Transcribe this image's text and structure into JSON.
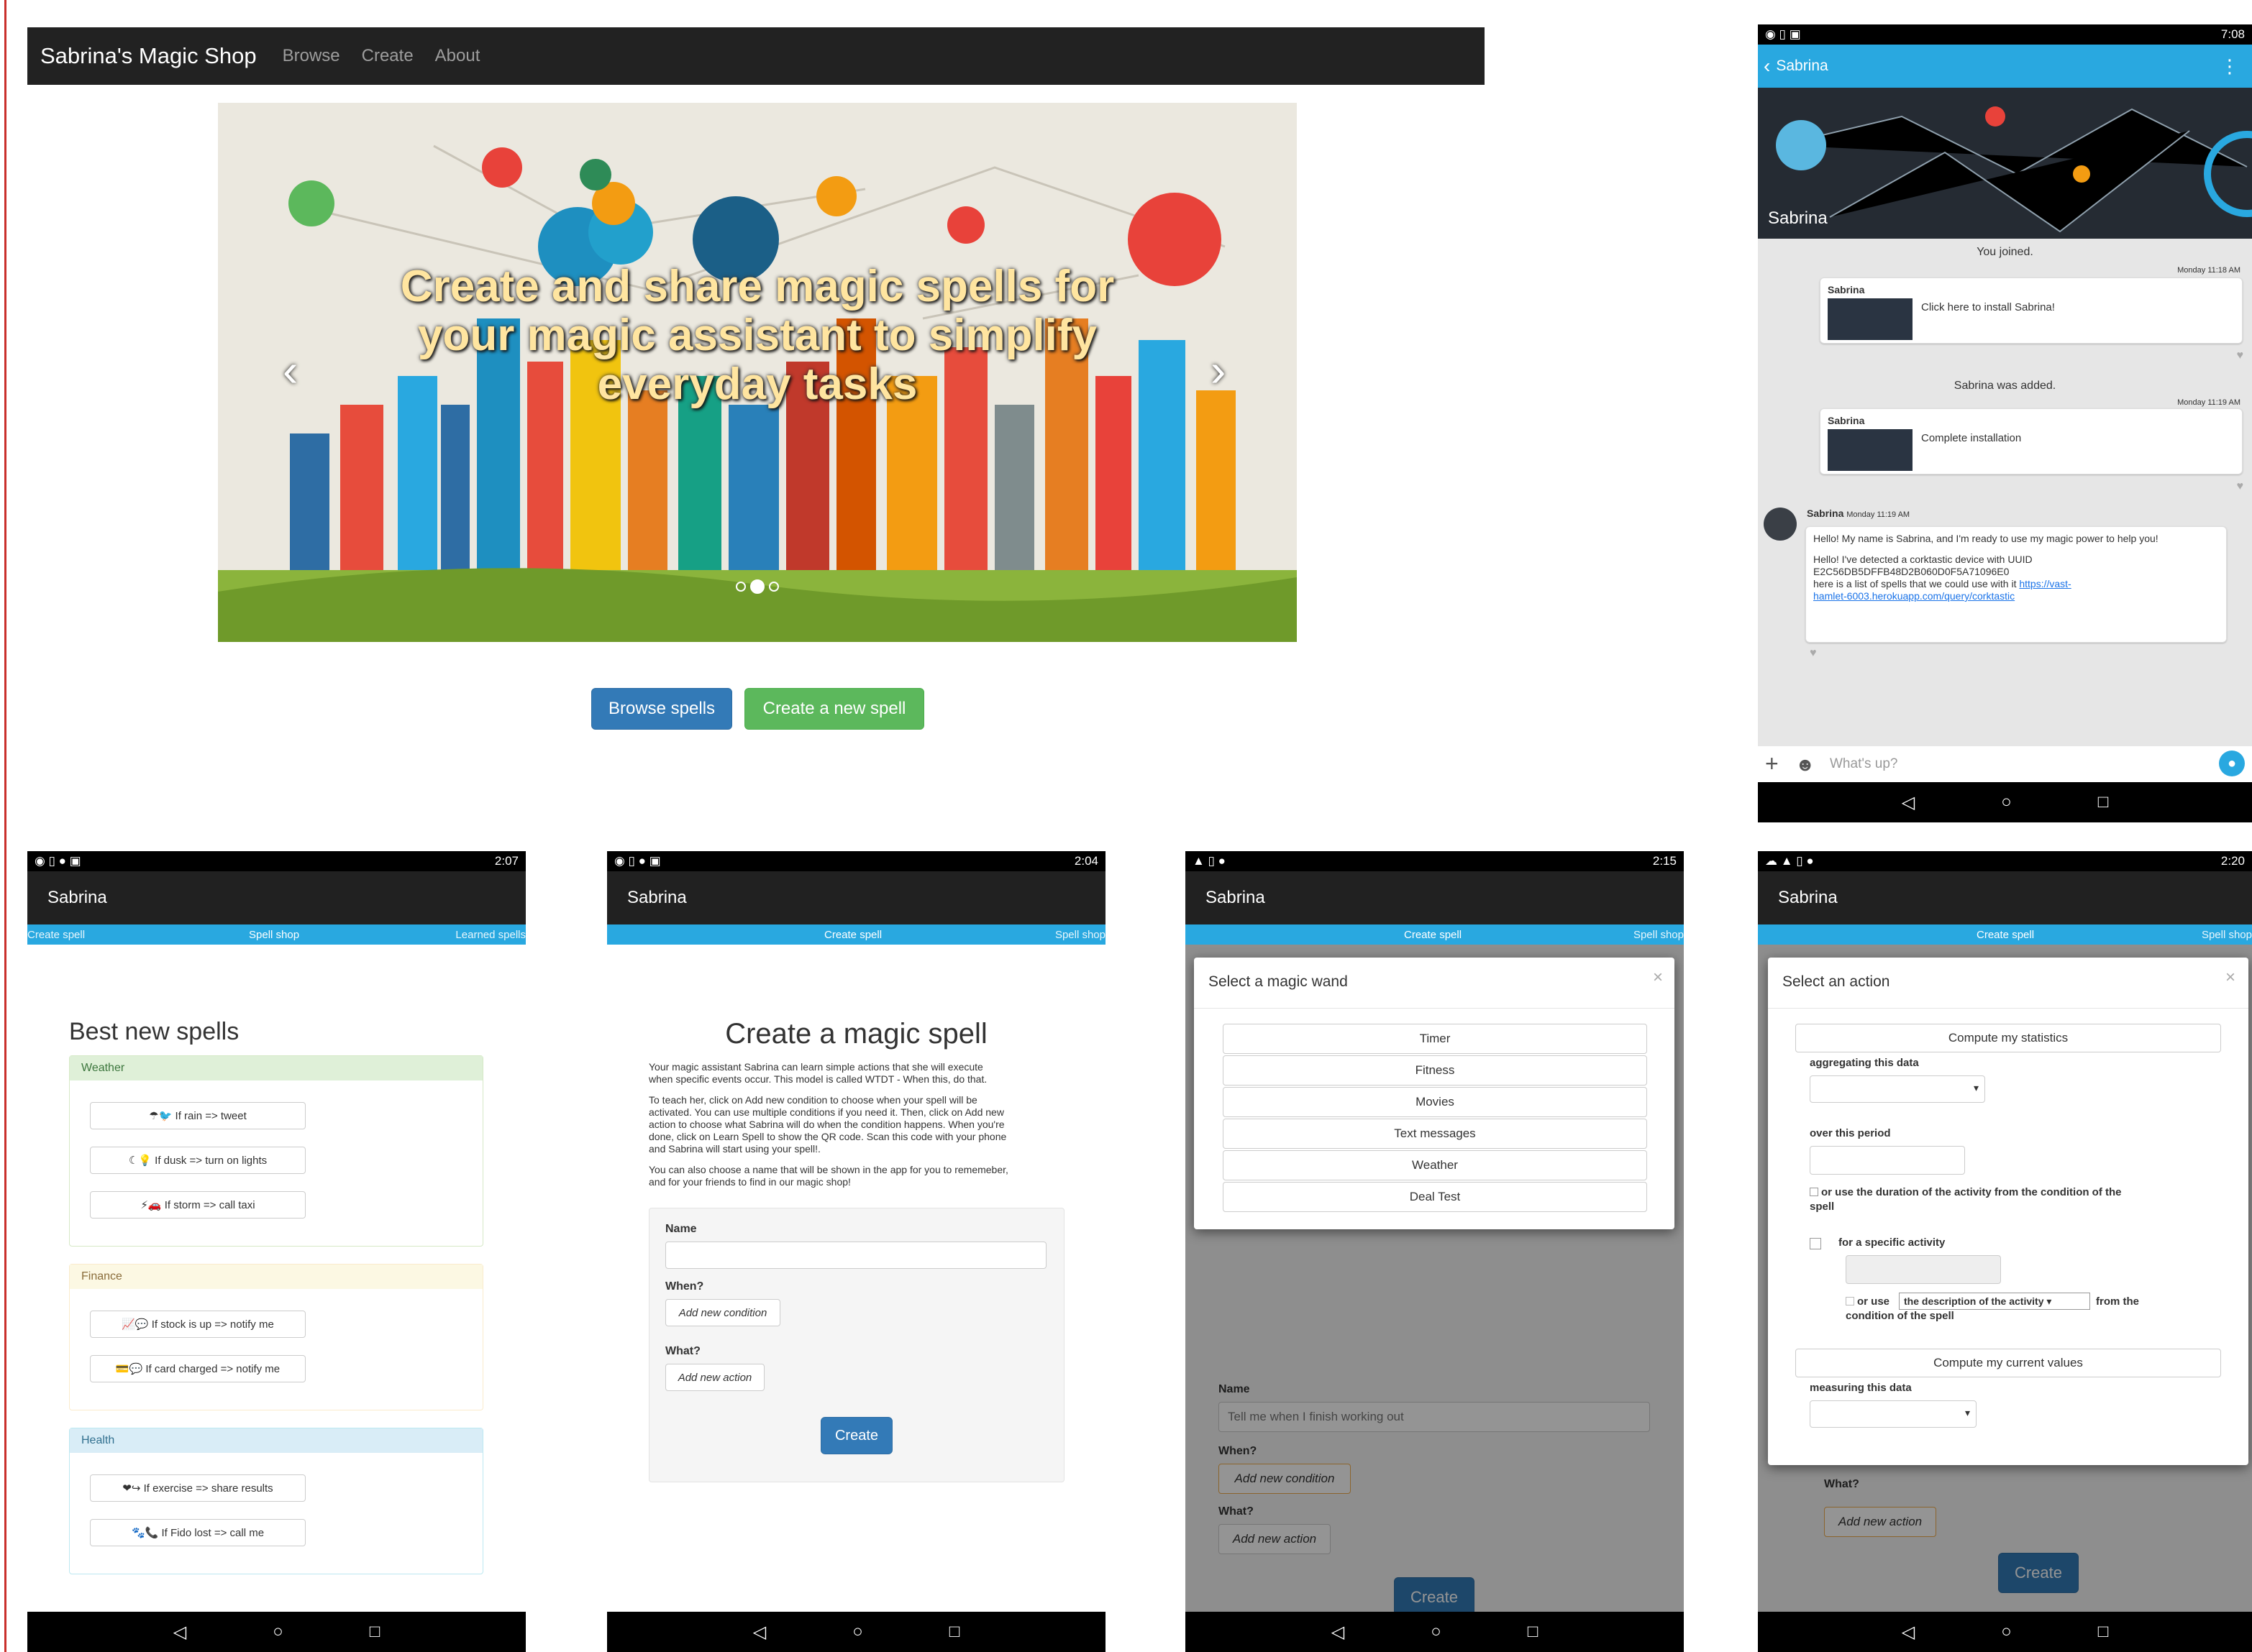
{
  "website": {
    "brand": "Sabrina's Magic Shop",
    "nav": [
      "Browse",
      "Create",
      "About"
    ],
    "carousel": {
      "caption": "Create and share magic spells for your magic assistant to simplify everyday tasks",
      "prev": "‹",
      "next": "›"
    },
    "buttons": {
      "browse": "Browse spells",
      "create": "Create a new spell"
    }
  },
  "chat": {
    "time": "7:08",
    "back_title": "Sabrina",
    "header_name": "Sabrina",
    "you_joined": "You joined.",
    "time1": "Monday 11:18 AM",
    "b1_name": "Sabrina",
    "b1_text": "Click here to install Sabrina!",
    "added": "Sabrina was added.",
    "time2": "Monday 11:19 AM",
    "b2_name": "Sabrina",
    "b2_text": "Complete installation",
    "msg_name": "Sabrina",
    "msg_time": "Monday 11:19 AM",
    "msg_l1": "Hello! My name is Sabrina, and I'm ready to use my magic power to help you!",
    "msg_l2": "Hello! I've detected a corktastic device with UUID",
    "msg_l3": "E2C56DB5DFFB48D2B060D0F5A71096E0",
    "msg_l4": "here is a list of spells that we could use with it",
    "msg_link1": "https://vast-",
    "msg_link2": "hamlet-6003.herokuapp.com/query/corktastic",
    "placeholder": "What's up?"
  },
  "spellshop": {
    "time": "2:07",
    "app": "Sabrina",
    "tabs": [
      "Create spell",
      "Spell shop",
      "Learned spells"
    ],
    "heading": "Best new spells",
    "cats": [
      {
        "name": "Weather",
        "spells": [
          "☂🐦 If rain => tweet",
          "☾💡 If dusk => turn on lights",
          "⚡🚗 If storm => call taxi"
        ]
      },
      {
        "name": "Finance",
        "spells": [
          "📈💬 If stock is up => notify me",
          "💳💬 If card charged => notify me"
        ]
      },
      {
        "name": "Health",
        "spells": [
          "❤↪ If exercise => share results",
          "🐾📞 If Fido lost => call me"
        ]
      }
    ],
    "colors": {
      "weather": "#dff0d8",
      "finance": "#fcf8e3",
      "health": "#d9edf7"
    }
  },
  "create": {
    "time": "2:04",
    "app": "Sabrina",
    "tabs": [
      "Create spell",
      "Spell shop"
    ],
    "heading": "Create a magic spell",
    "p1a": "Your magic assistant Sabrina can learn simple actions that she will execute",
    "p1b": "when specific events occur. This model is called WTDT - When this, do that.",
    "p2a": "To teach her, click on Add new condition to choose when your spell will be",
    "p2b": "activated. You can use multiple conditions if you need it. Then, click on Add new",
    "p2c": "action to choose what Sabrina will do when the condition happens. When you're",
    "p2d": "done, click on Learn Spell to show the QR code. Scan this code with your phone",
    "p2e": "and Sabrina will start using your spell!.",
    "p3a": "You can also choose a name that will be shown in the app for you to rememeber,",
    "p3b": "and for your friends to find in our magic shop!",
    "name_label": "Name",
    "when_label": "When?",
    "add_condition": "Add new condition",
    "what_label": "What?",
    "add_action": "Add new action",
    "create_btn": "Create"
  },
  "wand": {
    "time": "2:15",
    "app": "Sabrina",
    "tabs": [
      "Create spell",
      "Spell shop"
    ],
    "title": "Select a magic wand",
    "close": "×",
    "items": [
      "Timer",
      "Fitness",
      "Movies",
      "Text messages",
      "Weather",
      "Deal Test"
    ],
    "name_label": "Name",
    "name_value": "Tell me when I finish working out",
    "when_label": "When?",
    "add_condition": "Add new condition",
    "what_label": "What?",
    "add_action": "Add new action",
    "create_btn": "Create"
  },
  "action": {
    "time": "2:20",
    "app": "Sabrina",
    "tabs": [
      "Create spell",
      "Spell shop"
    ],
    "title": "Select an action",
    "close": "×",
    "stats_btn": "Compute my statistics",
    "agg_label": "aggregating this data",
    "period_label": "over this period",
    "dur_a": "or use the duration of the activity from the condition of the",
    "dur_b": "spell",
    "specific_label": "for a specific activity",
    "or_use": "or use",
    "desc_sel": "the description of the activity ▾",
    "from_the": "from the",
    "cond_spell": "condition of the spell",
    "values_btn": "Compute my current values",
    "measure_label": "measuring this data",
    "what_label": "What?",
    "add_action": "Add new action",
    "create_btn": "Create"
  }
}
